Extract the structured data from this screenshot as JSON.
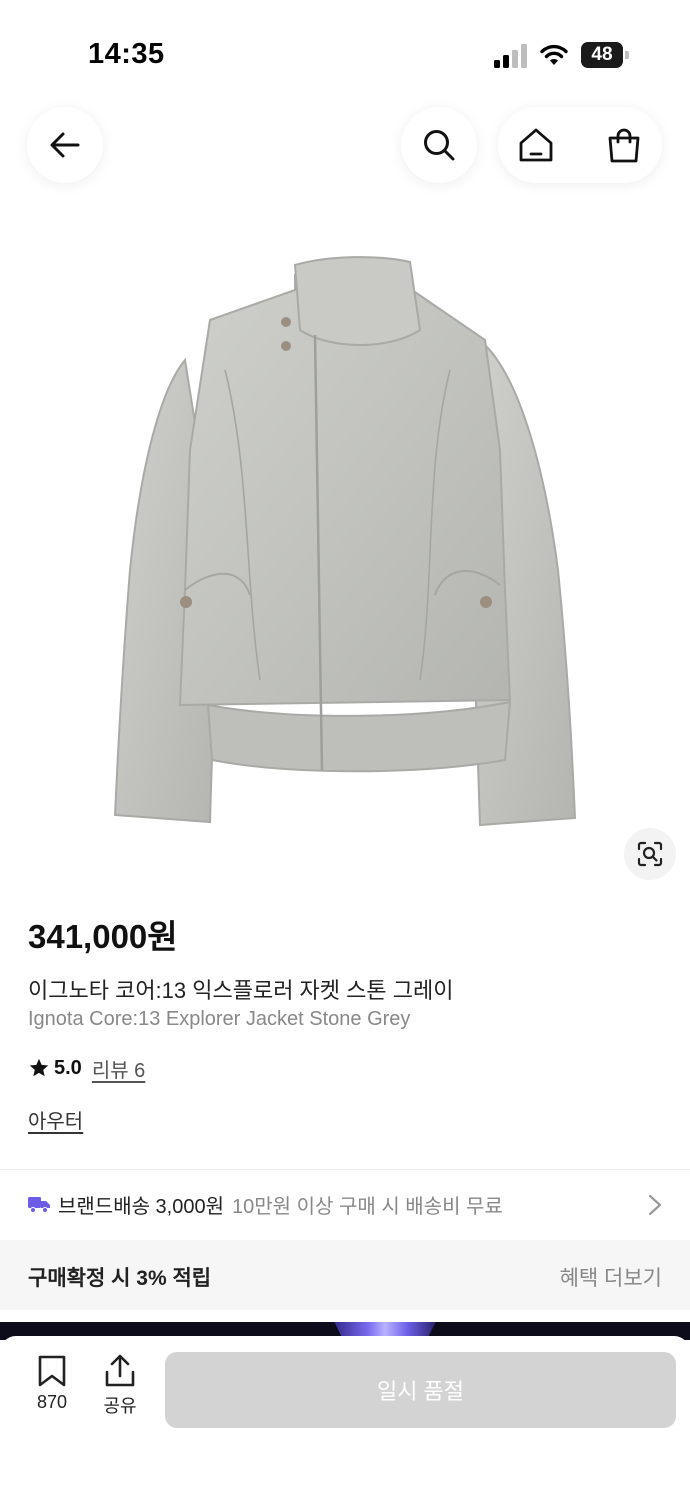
{
  "status_bar": {
    "time": "14:35",
    "battery": "48",
    "icons": [
      "signal-icon",
      "wifi-icon",
      "battery-icon"
    ]
  },
  "nav": {
    "icons": [
      "back-arrow-icon",
      "search-icon",
      "home-icon",
      "shopping-bag-icon"
    ]
  },
  "product": {
    "image_alt_icon": "jacket-image",
    "lens_icon": "image-search-icon",
    "price": "341,000원",
    "name_ko": "이그노타 코어:13 익스플로러 자켓 스톤 그레이",
    "name_en": "Ignota Core:13 Explorer Jacket Stone Grey",
    "rating": "5.0",
    "review_link": "리뷰 6",
    "category": "아우터"
  },
  "shipping": {
    "label": "브랜드배송 3,000원",
    "note": "10만원 이상 구매 시 배송비 무료",
    "icon": "truck-icon"
  },
  "benefit": {
    "label": "구매확정 시 3% 적립",
    "more": "혜택 더보기"
  },
  "bottom_bar": {
    "wish_count": "870",
    "share_label": "공유",
    "soldout_label": "일시 품절"
  },
  "colors": {
    "accent_purple": "#6c5ce7",
    "soldout_bg": "#d3d3d3",
    "text_primary": "#111111",
    "text_secondary": "#888888"
  }
}
